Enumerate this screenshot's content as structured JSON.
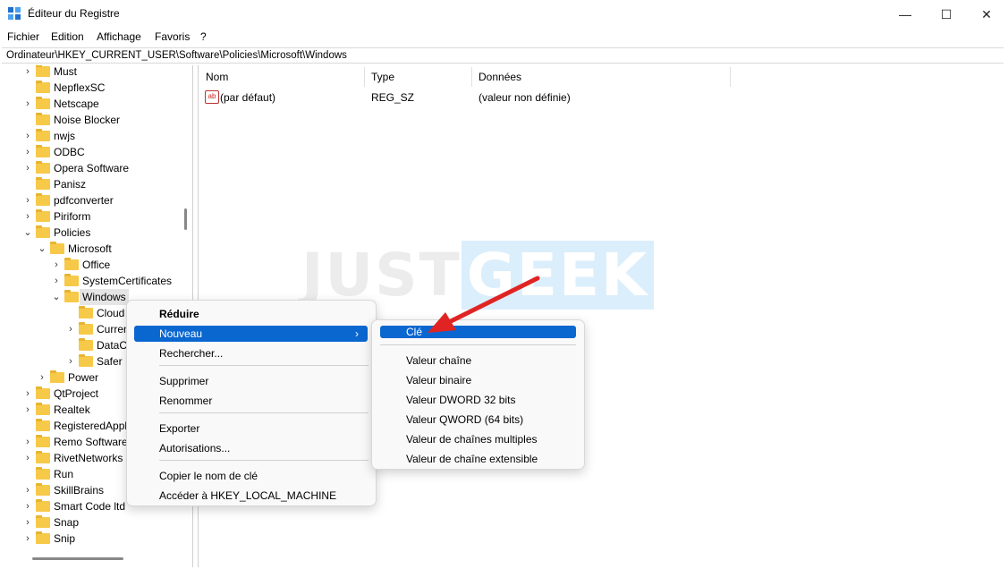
{
  "window": {
    "title": "Éditeur du Registre",
    "buttons": {
      "minimize": "—",
      "maximize": "☐",
      "close": "✕"
    }
  },
  "menu": [
    "Fichier",
    "Edition",
    "Affichage",
    "Favoris",
    "?"
  ],
  "address": "Ordinateur\\HKEY_CURRENT_USER\\Software\\Policies\\Microsoft\\Windows",
  "tree": [
    {
      "label": "Must",
      "chev": "›"
    },
    {
      "label": "NepflexSC",
      "chev": ""
    },
    {
      "label": "Netscape",
      "chev": "›"
    },
    {
      "label": "Noise Blocker",
      "chev": ""
    },
    {
      "label": "nwjs",
      "chev": "›"
    },
    {
      "label": "ODBC",
      "chev": "›"
    },
    {
      "label": "Opera Software",
      "chev": "›"
    },
    {
      "label": "Panisz",
      "chev": ""
    },
    {
      "label": "pdfconverter",
      "chev": "›"
    },
    {
      "label": "Piriform",
      "chev": "›"
    },
    {
      "label": "Policies",
      "chev": "⌄"
    },
    {
      "label": "Microsoft",
      "chev": "⌄"
    },
    {
      "label": "Office",
      "chev": "›"
    },
    {
      "label": "SystemCertificates",
      "chev": "›"
    },
    {
      "label": "Windows",
      "chev": "⌄"
    },
    {
      "label": "Cloud",
      "chev": ""
    },
    {
      "label": "Curren",
      "chev": "›"
    },
    {
      "label": "DataC",
      "chev": ""
    },
    {
      "label": "Safer",
      "chev": "›"
    },
    {
      "label": "Power",
      "chev": "›"
    },
    {
      "label": "QtProject",
      "chev": "›"
    },
    {
      "label": "Realtek",
      "chev": "›"
    },
    {
      "label": "RegisteredAppl",
      "chev": ""
    },
    {
      "label": "Remo Software",
      "chev": "›"
    },
    {
      "label": "RivetNetworks",
      "chev": "›"
    },
    {
      "label": "Run",
      "chev": ""
    },
    {
      "label": "SkillBrains",
      "chev": "›"
    },
    {
      "label": "Smart Code ltd",
      "chev": "›"
    },
    {
      "label": "Snap",
      "chev": "›"
    },
    {
      "label": "Snip",
      "chev": "›"
    }
  ],
  "columns": {
    "name": "Nom",
    "type": "Type",
    "data": "Données"
  },
  "values": [
    {
      "icon": "ab",
      "name": "(par défaut)",
      "type": "REG_SZ",
      "data": "(valeur non définie)"
    }
  ],
  "watermark": {
    "part1": "JUST",
    "part2": "GEEK"
  },
  "context_menu": [
    "Réduire",
    "Nouveau",
    "Rechercher...",
    "Supprimer",
    "Renommer",
    "Exporter",
    "Autorisations...",
    "Copier le nom de clé",
    "Accéder à HKEY_LOCAL_MACHINE"
  ],
  "context_submenu_arrow": "›",
  "submenu": [
    "Clé",
    "Valeur chaîne",
    "Valeur binaire",
    "Valeur DWORD 32 bits",
    "Valeur QWORD (64 bits)",
    "Valeur de chaînes multiples",
    "Valeur de chaîne extensible"
  ],
  "colors": {
    "highlight": "#0a67d0",
    "arrow": "#e02424",
    "folder": "#f7c948"
  }
}
